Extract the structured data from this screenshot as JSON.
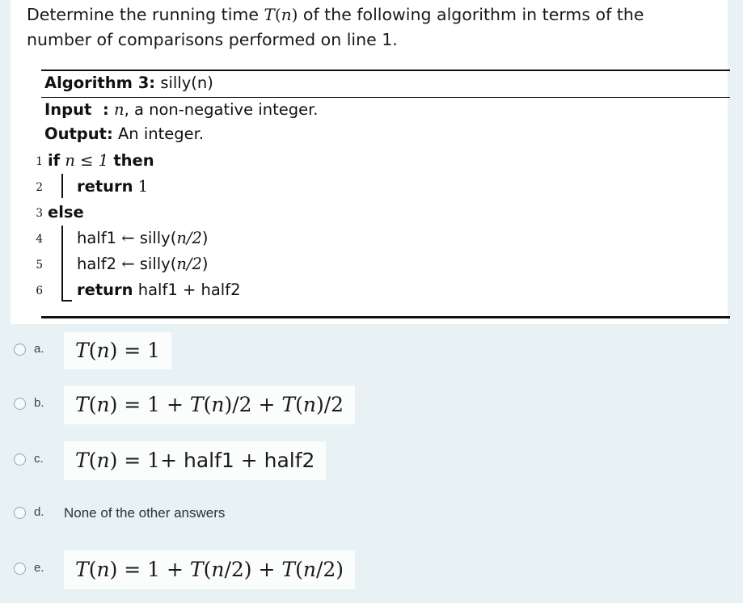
{
  "question": {
    "line1_pre": "Determine the running time ",
    "line1_math": "T(n)",
    "line1_post": " of the following algorithm in terms of the",
    "line2": "number of comparisons performed on line 1."
  },
  "algorithm": {
    "title_label": "Algorithm 3:",
    "title_name": "silly(n)",
    "input_label": "Input",
    "input_colon": ":",
    "input_value_var": "n",
    "input_value_rest": ", a non-negative integer.",
    "output_label": "Output:",
    "output_value": "An integer.",
    "lines": [
      {
        "no": "1",
        "text": "if n ≤ 1 then"
      },
      {
        "no": "2",
        "text": "return 1"
      },
      {
        "no": "3",
        "text": "else"
      },
      {
        "no": "4",
        "text": "half1 ← silly(n/2)"
      },
      {
        "no": "5",
        "text": "half2 ← silly(n/2)"
      },
      {
        "no": "6",
        "text": "return half1 + half2"
      }
    ],
    "tokens": {
      "kw_if": "if",
      "var_n": "n",
      "op_le": "≤",
      "num_1": "1",
      "kw_then": "then",
      "kw_return": "return",
      "val_1": "1",
      "kw_else": "else",
      "half1": "half1",
      "half2": "half2",
      "arrow": "←",
      "call": "silly(",
      "call_close": ")",
      "n_over_2": "n/2",
      "plus": "+"
    }
  },
  "answers": [
    {
      "letter": "a.",
      "type": "formula",
      "text": "T(n) = 1",
      "selected": false
    },
    {
      "letter": "b.",
      "type": "formula",
      "text": "T(n) = 1 + T(n)/2 + T(n)/2",
      "selected": false
    },
    {
      "letter": "c.",
      "type": "formula",
      "text": "T(n) = 1+ half1 + half2",
      "selected": false
    },
    {
      "letter": "d.",
      "type": "text",
      "text": "None of the other answers",
      "selected": false
    },
    {
      "letter": "e.",
      "type": "formula",
      "text": "T(n) = 1 + T(n/2) + T(n/2)",
      "selected": false
    }
  ],
  "colors": {
    "page_background": "#e8f1f4",
    "panel_background": "#ffffff",
    "formula_background": "#fbfcfc",
    "text": "#1a1a1a",
    "radio_border": "#9aa5ac"
  }
}
